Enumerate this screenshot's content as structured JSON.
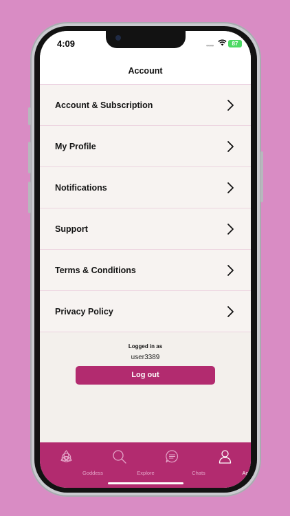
{
  "status_bar": {
    "time": "4:09",
    "battery": "87"
  },
  "header": {
    "title": "Account"
  },
  "menu": {
    "items": [
      {
        "label": "Account & Subscription"
      },
      {
        "label": "My Profile"
      },
      {
        "label": "Notifications"
      },
      {
        "label": "Support"
      },
      {
        "label": "Terms & Conditions"
      },
      {
        "label": "Privacy Policy"
      }
    ]
  },
  "session": {
    "logged_in_label": "Logged in as",
    "username": "user3389",
    "logout_label": "Log out"
  },
  "tab_bar": {
    "tabs": [
      {
        "label": "Goddess",
        "icon": "triquetra-icon"
      },
      {
        "label": "Explore",
        "icon": "search-icon"
      },
      {
        "label": "Chats",
        "icon": "chat-bubble-icon"
      },
      {
        "label": "Account",
        "icon": "user-icon"
      }
    ],
    "active_tab": "Account"
  },
  "colors": {
    "background": "#d98cc4",
    "accent": "#b22b6f",
    "list_background": "#f7f3f1"
  }
}
